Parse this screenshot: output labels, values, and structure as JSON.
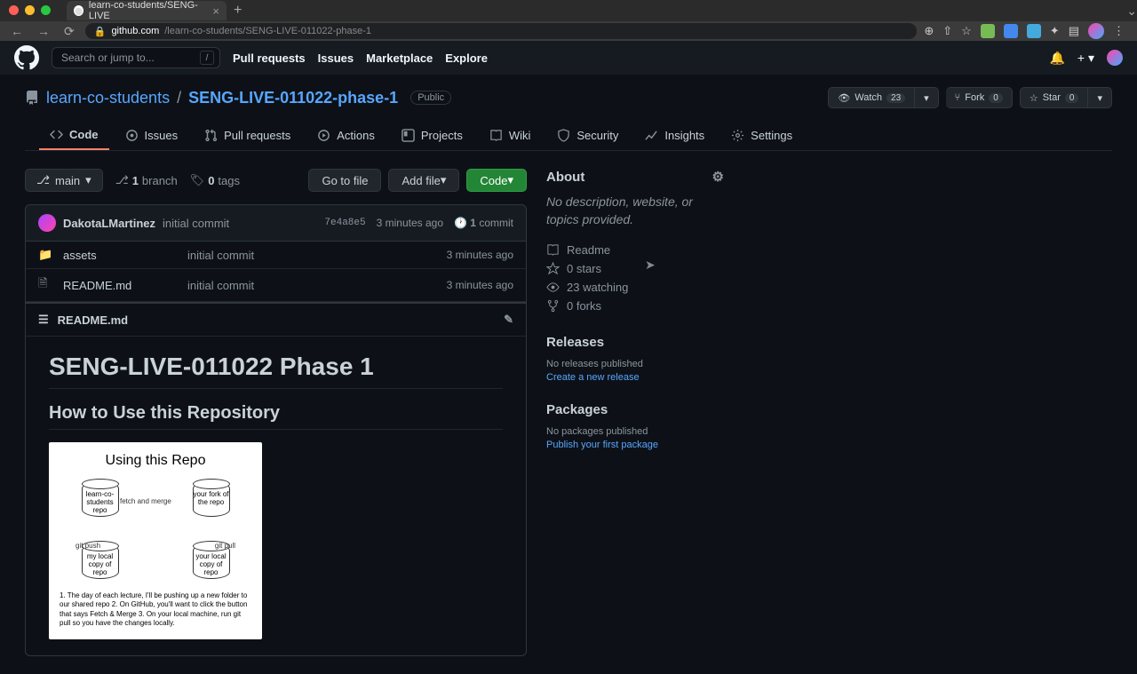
{
  "browser": {
    "tab_title": "learn-co-students/SENG-LIVE",
    "url_domain": "github.com",
    "url_path": "/learn-co-students/SENG-LIVE-011022-phase-1"
  },
  "header": {
    "search_placeholder": "Search or jump to...",
    "nav": {
      "pulls": "Pull requests",
      "issues": "Issues",
      "marketplace": "Marketplace",
      "explore": "Explore"
    }
  },
  "repo": {
    "owner": "learn-co-students",
    "name": "SENG-LIVE-011022-phase-1",
    "visibility": "Public",
    "watch": {
      "label": "Watch",
      "count": "23"
    },
    "fork": {
      "label": "Fork",
      "count": "0"
    },
    "star": {
      "label": "Star",
      "count": "0"
    }
  },
  "tabs": {
    "code": "Code",
    "issues": "Issues",
    "pulls": "Pull requests",
    "actions": "Actions",
    "projects": "Projects",
    "wiki": "Wiki",
    "security": "Security",
    "insights": "Insights",
    "settings": "Settings"
  },
  "files": {
    "branch": "main",
    "branch_count": "1",
    "branch_label": "branch",
    "tag_count": "0",
    "tag_label": "tags",
    "go_to_file": "Go to file",
    "add_file": "Add file",
    "code_btn": "Code",
    "commit": {
      "author": "DakotaLMartinez",
      "message": "initial commit",
      "hash": "7e4a8e5",
      "time": "3 minutes ago",
      "count": "1",
      "count_label": "commit"
    },
    "rows": [
      {
        "icon": "folder",
        "name": "assets",
        "msg": "initial commit",
        "time": "3 minutes ago"
      },
      {
        "icon": "file",
        "name": "README.md",
        "msg": "initial commit",
        "time": "3 minutes ago"
      }
    ]
  },
  "readme": {
    "filename": "README.md",
    "h1": "SENG-LIVE-011022 Phase 1",
    "h2": "How to Use this Repository",
    "diagram": {
      "title": "Using this Repo",
      "nodes": {
        "tl": "learn-co-students repo",
        "tr": "your fork of the repo",
        "bl": "my local copy of repo",
        "br": "your local copy of repo"
      },
      "edges": {
        "top": "fetch and merge",
        "left": "git push",
        "right": "git pull"
      },
      "steps": "1. The day of each lecture, I'll be pushing up a new folder to our shared repo\n2. On GitHub, you'll want to click the button that says Fetch & Merge\n3. On your local machine, run git pull so you have the changes locally."
    }
  },
  "about": {
    "title": "About",
    "description": "No description, website, or topics provided.",
    "links": {
      "readme": "Readme",
      "stars": "0 stars",
      "watching": "23 watching",
      "forks": "0 forks"
    }
  },
  "releases": {
    "title": "Releases",
    "sub": "No releases published",
    "action": "Create a new release"
  },
  "packages": {
    "title": "Packages",
    "sub": "No packages published",
    "action": "Publish your first package"
  }
}
